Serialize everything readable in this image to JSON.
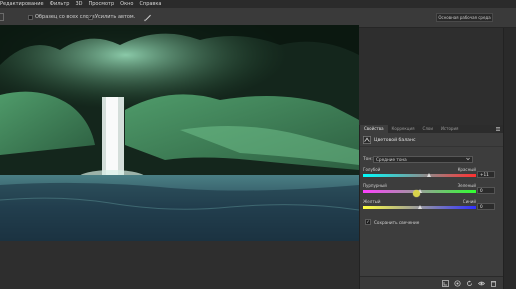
{
  "menubar": {
    "items": [
      "Редактирование",
      "Фильтр",
      "3D",
      "Просмотр",
      "Окно",
      "Справка"
    ]
  },
  "options": {
    "sample_all_layers": {
      "label": "Образец со всех слоев",
      "checked": false
    },
    "auto_enhance": {
      "label": "Усилить автом.",
      "checked": true
    },
    "workspace": "Основная рабочая среда",
    "brush_icon": "brush-icon"
  },
  "canvas": {
    "content": "Изображение: водопад в тропическом лесу"
  },
  "panel": {
    "tabs": [
      "Свойства",
      "Коррекция",
      "Слои",
      "История"
    ],
    "active_tab": 0,
    "adjustment_title": "Цветовой баланс",
    "tone": {
      "label": "Тон:",
      "value": "Средние тона"
    },
    "sliders": [
      {
        "left": "Голубой",
        "right": "Красный",
        "value": "+11",
        "fraction": 0.58
      },
      {
        "left": "Пурпурный",
        "right": "Зеленый",
        "value": "0",
        "fraction": 0.5
      },
      {
        "left": "Желтый",
        "right": "Синий",
        "value": "0",
        "fraction": 0.5
      }
    ],
    "preserve_luminosity": {
      "label": "Сохранить свечение",
      "checked": true
    },
    "footer_icons": [
      "clip-layer-icon",
      "view-previous-icon",
      "reset-icon",
      "visibility-icon",
      "trash-icon"
    ]
  },
  "colors": {
    "accent_cursor": "#d8d34a",
    "panel_bg": "#3d3d3d",
    "app_bg": "#323232"
  }
}
